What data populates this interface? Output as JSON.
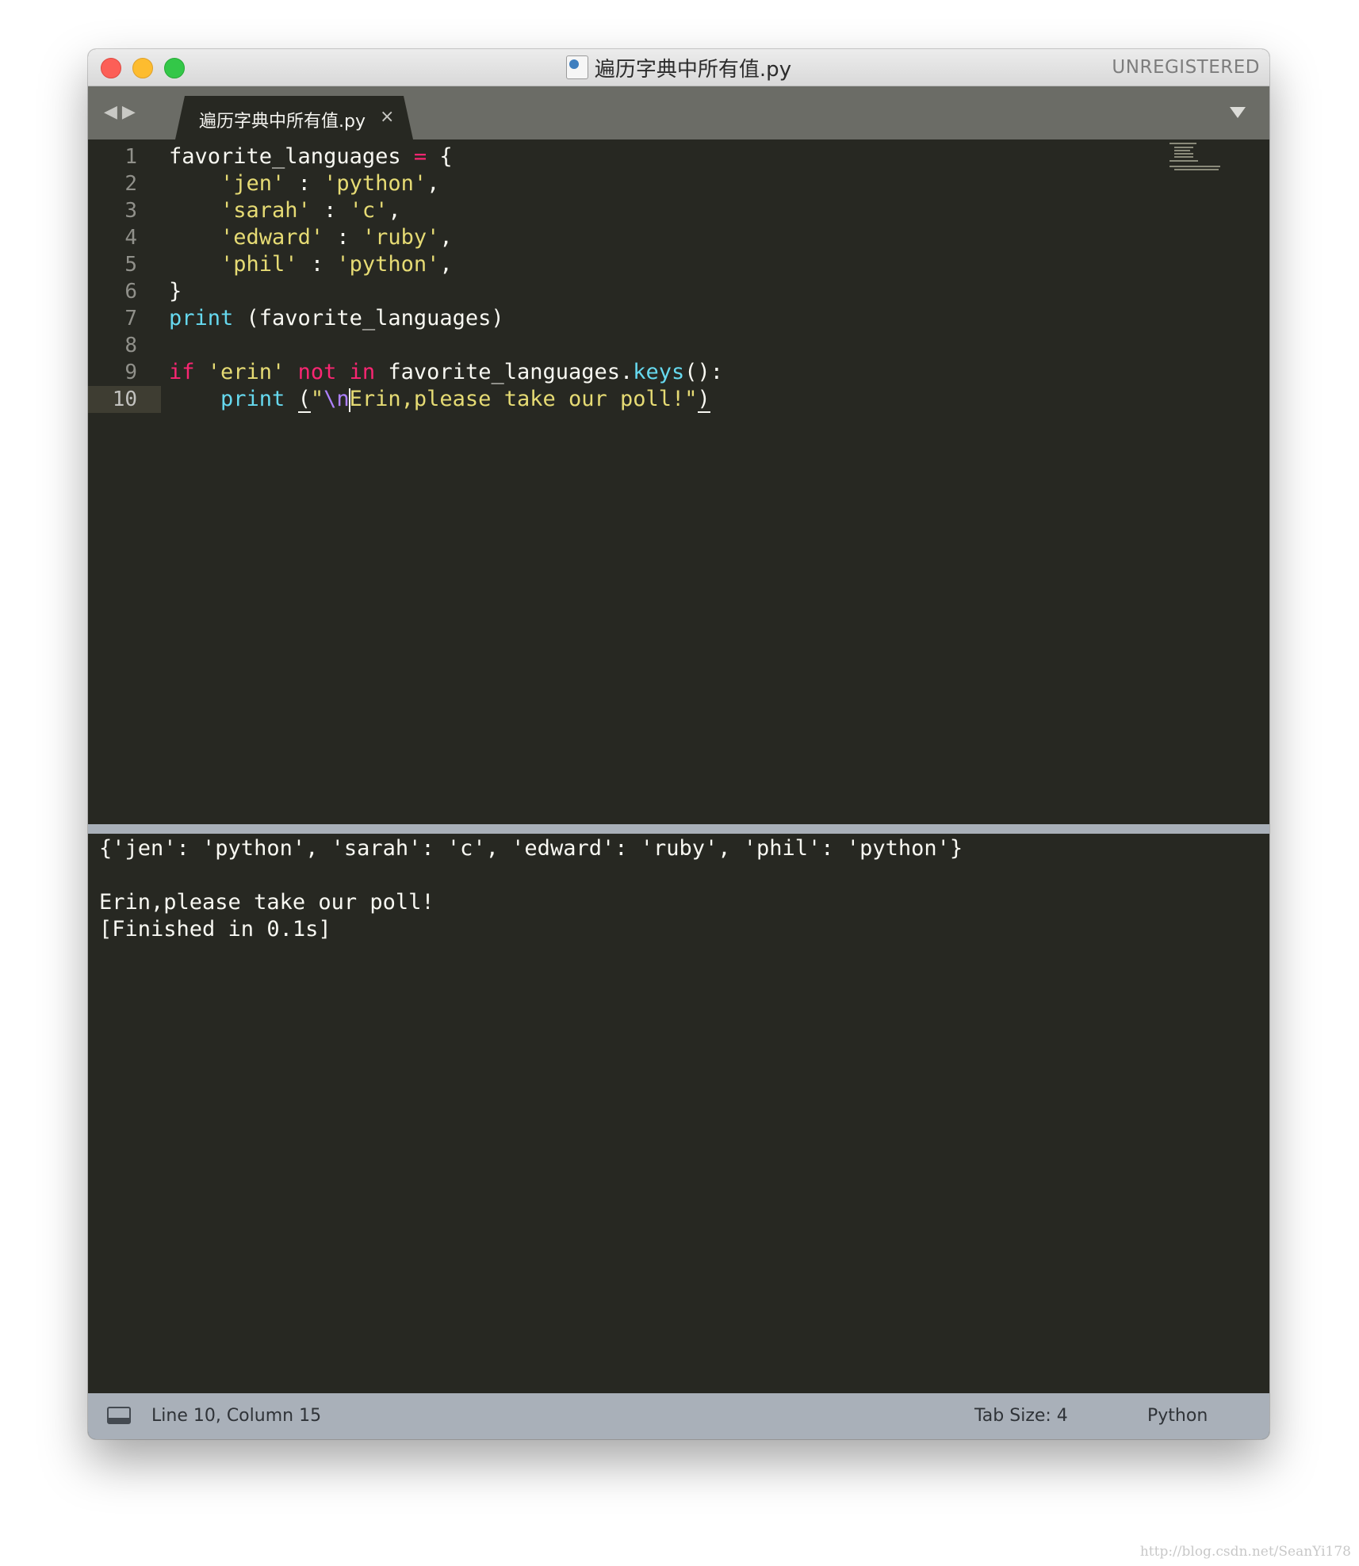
{
  "window": {
    "title": "遍历字典中所有值.py",
    "unregistered_label": "UNREGISTERED"
  },
  "tabs": [
    {
      "label": "遍历字典中所有值.py",
      "close_glyph": "×"
    }
  ],
  "nav": {
    "back_glyph": "◀",
    "forward_glyph": "▶"
  },
  "editor": {
    "line_numbers": [
      "1",
      "2",
      "3",
      "4",
      "5",
      "6",
      "7",
      "8",
      "9",
      "10"
    ],
    "active_line": 10,
    "lines": [
      {
        "tokens": [
          [
            "plain",
            "favorite_languages "
          ],
          [
            "op",
            "="
          ],
          [
            "plain",
            " {"
          ]
        ]
      },
      {
        "tokens": [
          [
            "plain",
            "    "
          ],
          [
            "str",
            "'jen'"
          ],
          [
            "plain",
            " : "
          ],
          [
            "str",
            "'python'"
          ],
          [
            "plain",
            ","
          ]
        ]
      },
      {
        "tokens": [
          [
            "plain",
            "    "
          ],
          [
            "str",
            "'sarah'"
          ],
          [
            "plain",
            " : "
          ],
          [
            "str",
            "'c'"
          ],
          [
            "plain",
            ","
          ]
        ]
      },
      {
        "tokens": [
          [
            "plain",
            "    "
          ],
          [
            "str",
            "'edward'"
          ],
          [
            "plain",
            " : "
          ],
          [
            "str",
            "'ruby'"
          ],
          [
            "plain",
            ","
          ]
        ]
      },
      {
        "tokens": [
          [
            "plain",
            "    "
          ],
          [
            "str",
            "'phil'"
          ],
          [
            "plain",
            " : "
          ],
          [
            "str",
            "'python'"
          ],
          [
            "plain",
            ","
          ]
        ]
      },
      {
        "tokens": [
          [
            "plain",
            "}"
          ]
        ]
      },
      {
        "tokens": [
          [
            "fn",
            "print"
          ],
          [
            "plain",
            " (favorite_languages)"
          ]
        ]
      },
      {
        "tokens": []
      },
      {
        "tokens": [
          [
            "kw",
            "if"
          ],
          [
            "plain",
            " "
          ],
          [
            "str",
            "'erin'"
          ],
          [
            "plain",
            " "
          ],
          [
            "kw",
            "not"
          ],
          [
            "plain",
            " "
          ],
          [
            "kw",
            "in"
          ],
          [
            "plain",
            " favorite_languages."
          ],
          [
            "fn",
            "keys"
          ],
          [
            "plain",
            "():"
          ]
        ]
      },
      {
        "tokens": [
          [
            "plain",
            "    "
          ],
          [
            "fn",
            "print"
          ],
          [
            "plain",
            " "
          ],
          [
            "uline",
            "("
          ],
          [
            "str",
            "\""
          ],
          [
            "esc",
            "\\n"
          ],
          [
            "cursor",
            ""
          ],
          [
            "str",
            "Erin,please take our poll!\""
          ],
          [
            "uline",
            ")"
          ]
        ]
      }
    ]
  },
  "output": {
    "lines": [
      "{'jen': 'python', 'sarah': 'c', 'edward': 'ruby', 'phil': 'python'}",
      "",
      "Erin,please take our poll!",
      "[Finished in 0.1s]"
    ]
  },
  "status": {
    "position": "Line 10, Column 15",
    "tab_size": "Tab Size: 4",
    "syntax": "Python"
  },
  "watermark": "http://blog.csdn.net/SeanYi178",
  "colors": {
    "background": "#272822",
    "keyword": "#f92672",
    "string": "#e6db74",
    "function": "#66d9ef",
    "escape": "#ae81ff",
    "status_bar": "#a9b0b9"
  }
}
